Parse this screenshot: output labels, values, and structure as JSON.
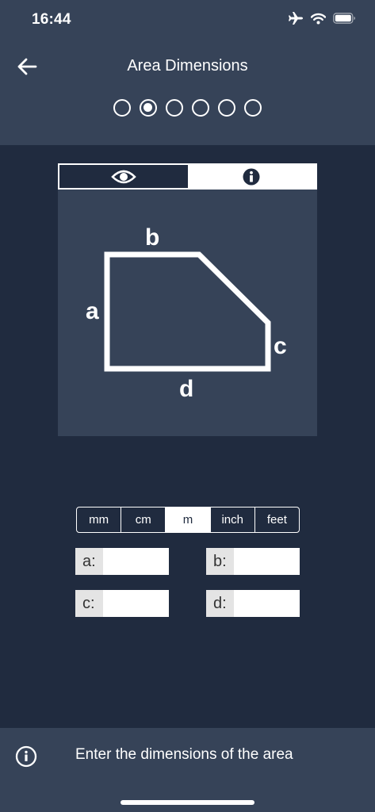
{
  "status_bar": {
    "time": "16:44"
  },
  "header": {
    "title": "Area Dimensions"
  },
  "steps": {
    "count": 6,
    "active_index": 1
  },
  "diagram": {
    "labels": {
      "a": "a",
      "b": "b",
      "c": "c",
      "d": "d"
    }
  },
  "units": {
    "options": [
      "mm",
      "cm",
      "m",
      "inch",
      "feet"
    ],
    "selected": "m"
  },
  "fields": {
    "a": {
      "label": "a:",
      "value": ""
    },
    "b": {
      "label": "b:",
      "value": ""
    },
    "c": {
      "label": "c:",
      "value": ""
    },
    "d": {
      "label": "d:",
      "value": ""
    }
  },
  "footer": {
    "hint": "Enter the dimensions of the area"
  },
  "colors": {
    "background": "#202b3f",
    "panel": "#364358",
    "foreground": "#ffffff"
  }
}
